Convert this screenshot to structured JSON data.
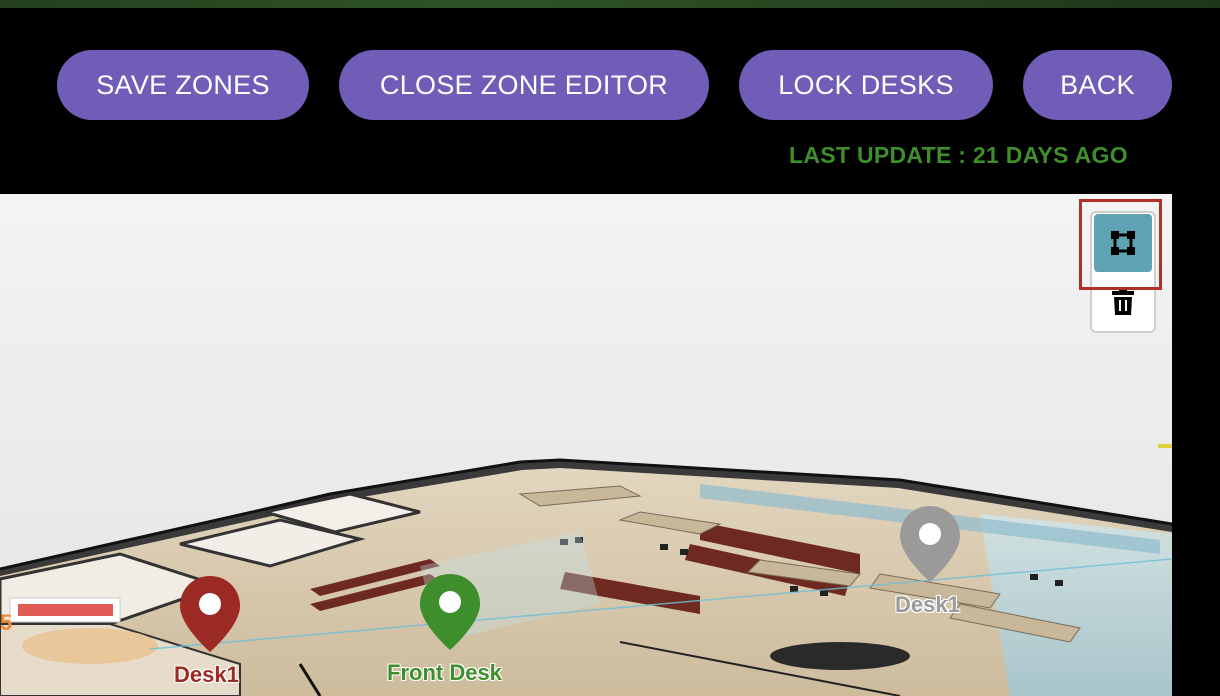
{
  "toolbar": {
    "save_label": "SAVE ZONES",
    "close_label": "CLOSE ZONE EDITOR",
    "lock_label": "LOCK DESKS",
    "back_label": "BACK"
  },
  "status": {
    "last_update": "LAST UPDATE : 21 DAYS AGO"
  },
  "map": {
    "tools": [
      {
        "name": "draw-polygon",
        "icon": "square-nodes-icon",
        "active": true
      },
      {
        "name": "delete",
        "icon": "trash-icon",
        "active": false
      }
    ],
    "edge_label": "5",
    "pins": [
      {
        "label": "Desk1",
        "color": "#9c2a24"
      },
      {
        "label": "Front Desk",
        "color": "#3e8f2b"
      },
      {
        "label": "Desk1",
        "color": "#9a9a9a"
      }
    ]
  },
  "colors": {
    "button_bg": "#6f5db8",
    "status_green": "#3e8f2b",
    "tool_active": "#5fa3b5",
    "highlight": "#b3302a"
  }
}
